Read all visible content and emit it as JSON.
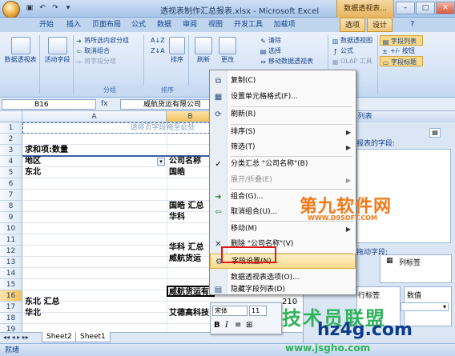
{
  "title": {
    "text": "透视表制作汇总报表.xlsx - Microsoft Excel",
    "context_tab_group": "数据透视表..."
  },
  "tabs": [
    "开始",
    "插入",
    "页面布局",
    "公式",
    "数据",
    "审阅",
    "视图",
    "开发工具",
    "加载项",
    "选项",
    "设计"
  ],
  "ribbon": {
    "pivot_table_label": "数据透视表",
    "active_field_label": "活动字段",
    "group": {
      "items": [
        "将所选内容分组",
        "取消组合",
        "将字段分组"
      ],
      "label": "分组"
    },
    "sort": {
      "button": "排序",
      "label": "排序"
    },
    "refresh": "刷新",
    "change": "更改",
    "data": {
      "clear": "清除",
      "select": "选择",
      "move": "移动数据透视表"
    },
    "tools": {
      "pivot_chart": "数据透视图",
      "formula": "公式",
      "olap": "OLAP 工具"
    },
    "show_hide": {
      "field_list": "字段列表",
      "buttons": "+/- 按钮",
      "headers": "字段标题"
    }
  },
  "formula_bar": {
    "name_box": "B16",
    "content": "威航货运有限公司"
  },
  "sheet": {
    "columns": [
      "A",
      "B"
    ],
    "rows": [
      "1",
      "2",
      "3",
      "4",
      "5",
      "6",
      "7",
      "8",
      "9",
      "10",
      "11",
      "12",
      "13",
      "14",
      "15",
      "16",
      "17",
      "18",
      "19"
    ],
    "placeholder": "请将页字段拖至此处",
    "r3_a": "求和项:数量",
    "r4_a": "地区",
    "r4_b": "公司名称",
    "r5_a": "东北",
    "r5_b": "国皓",
    "r9_b": "国皓  汇总",
    "r10_b": "华科",
    "r13_b": "华科  汇总",
    "r14_b": "威航货运",
    "r16_b": "威航货运有限公司",
    "r17_a": "东北  汇总",
    "r18_a": "华北",
    "r18_b": "艾德高科技",
    "r18_c": "210"
  },
  "context_menu": {
    "items": [
      {
        "label": "复制(C)",
        "icon": "copy-icon"
      },
      {
        "label": "设置单元格格式(F)...",
        "icon": "format-cells-icon"
      },
      {
        "label": "刷新(R)",
        "icon": "refresh-icon"
      },
      {
        "label": "排序(S)",
        "has_submenu": true
      },
      {
        "label": "筛选(T)",
        "has_submenu": true
      },
      {
        "label": "分类汇总 \"公司名称\"(B)",
        "checked": true
      },
      {
        "label": "展开/折叠(E)",
        "has_submenu": true,
        "disabled": true
      },
      {
        "label": "组合(G)...",
        "icon": "group-icon"
      },
      {
        "label": "取消组合(U)...",
        "icon": "ungroup-icon"
      },
      {
        "label": "移动(M)",
        "has_submenu": true
      },
      {
        "label": "删除 \"公司名称\"(V)",
        "icon": "delete-icon"
      },
      {
        "label": "字段设置(N)...",
        "icon": "field-settings-icon",
        "highlighted": true
      },
      {
        "label": "数据透视表选项(O)..."
      },
      {
        "label": "隐藏字段列表(D)",
        "icon": "hide-field-list-icon"
      }
    ]
  },
  "mini_toolbar": {
    "font": "宋体",
    "size": "11"
  },
  "task_pane": {
    "title": "...列表",
    "field_prompt": "报表的字段:",
    "drag_prompt": "拖动字段:",
    "column_label": "列标签",
    "row_label": "行标签",
    "values_label": "数值"
  },
  "sheet_tabs": [
    "Sheet2",
    "Sheet1"
  ],
  "status": {
    "ready": "就绪"
  },
  "watermarks": {
    "site1_title": "第九软件网",
    "site1_url": "WWW.D9SOFT.COM",
    "site2_title": "技术员联盟",
    "site2_domain": "hz4g.com",
    "site2_url": "www.jsgho.com"
  },
  "colors": {
    "accent": "#15428b",
    "highlight_box": "#e01818",
    "watermark_orange": "#f07a1a",
    "watermark_green": "#2fb35a",
    "watermark_blue": "#0c3a8a"
  }
}
